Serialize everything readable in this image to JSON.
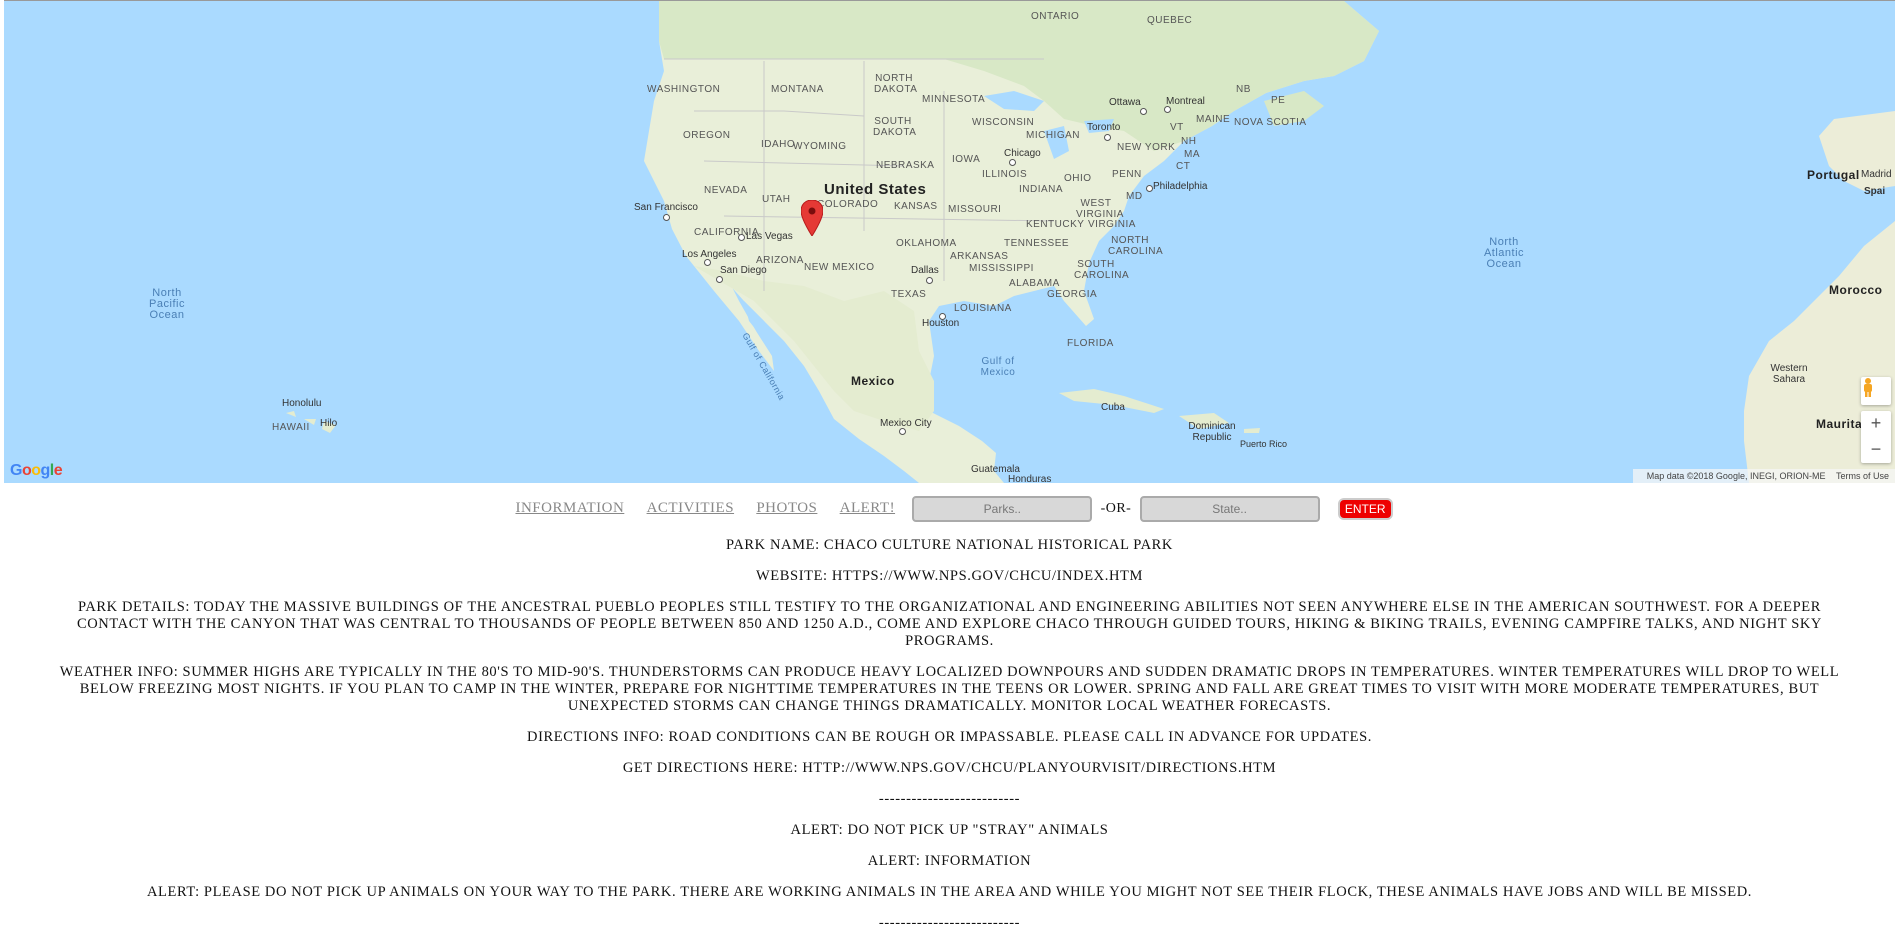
{
  "map": {
    "labels": {
      "united_states": "United States",
      "mexico": "Mexico",
      "portugal": "Portugal",
      "morocco": "Morocco",
      "mauritania": "Mauritania",
      "western_sahara": "Western Sahara",
      "cuba": "Cuba",
      "dominican_republic": "Dominican Republic",
      "puerto_rico": "Puerto Rico",
      "guatemala": "Guatemala",
      "honduras": "Honduras",
      "north_pacific_ocean": "North Pacific Ocean",
      "north_atlantic_ocean": "North Atlantic Ocean",
      "gulf_of_mexico": "Gulf of Mexico",
      "gulf_of_california": "Gulf of California",
      "ontario": "ONTARIO",
      "quebec": "QUEBEC",
      "washington": "WASHINGTON",
      "montana": "MONTANA",
      "north_dakota": "NORTH DAKOTA",
      "minnesota": "MINNESOTA",
      "south_dakota": "SOUTH DAKOTA",
      "wisconsin": "WISCONSIN",
      "michigan": "MICHIGAN",
      "oregon": "OREGON",
      "idaho": "IDAHO",
      "wyoming": "WYOMING",
      "nebraska": "NEBRASKA",
      "iowa": "IOWA",
      "illinois": "ILLINOIS",
      "indiana": "INDIANA",
      "ohio": "OHIO",
      "penn": "PENN",
      "nevada": "NEVADA",
      "utah": "UTAH",
      "colorado": "COLORADO",
      "kansas": "KANSAS",
      "missouri": "MISSOURI",
      "kentucky": "KENTUCKY",
      "west_virginia": "WEST VIRGINIA",
      "virginia": "VIRGINIA",
      "california": "CALIFORNIA",
      "arizona": "ARIZONA",
      "new_mexico": "NEW MEXICO",
      "oklahoma": "OKLAHOMA",
      "arkansas": "ARKANSAS",
      "tennessee": "TENNESSEE",
      "north_carolina": "NORTH CAROLINA",
      "south_carolina": "SOUTH CAROLINA",
      "mississippi": "MISSISSIPPI",
      "alabama": "ALABAMA",
      "georgia": "GEORGIA",
      "texas": "TEXAS",
      "louisiana": "LOUISIANA",
      "florida": "FLORIDA",
      "hawaii": "HAWAII",
      "new_york": "NEW YORK",
      "maine": "MAINE",
      "nova_scotia": "NOVA SCOTIA",
      "nb": "NB",
      "pe": "PE",
      "vt": "VT",
      "nh": "NH",
      "ma": "MA",
      "ct": "CT",
      "md": "MD",
      "san_francisco": "San Francisco",
      "las_vegas": "Las Vegas",
      "los_angeles": "Los Angeles",
      "san_diego": "San Diego",
      "dallas": "Dallas",
      "houston": "Houston",
      "chicago": "Chicago",
      "toronto": "Toronto",
      "ottawa": "Ottawa",
      "montreal": "Montreal",
      "philadelphia": "Philadelphia",
      "mexico_city": "Mexico City",
      "honolulu": "Honolulu",
      "hilo": "Hilo",
      "madrid": "Madrid",
      "spain": "Spai"
    },
    "attribution": "Map data ©2018 Google, INEGI, ORION-ME",
    "terms": "Terms of Use",
    "zoom_in": "+",
    "zoom_out": "−",
    "google_logo_letters": [
      "G",
      "o",
      "o",
      "g",
      "l",
      "e"
    ],
    "colors": {
      "water": "#aadaff",
      "land": "#e8eed8",
      "marker": "#e53935"
    }
  },
  "nav": {
    "information": "INFORMATION",
    "activities": "ACTIVITIES",
    "photos": "PHOTOS",
    "alert": "ALERT!",
    "parks_placeholder": "Parks..",
    "or_label": "-OR-",
    "state_placeholder": "State..",
    "enter": "ENTER"
  },
  "content": {
    "park_name": "PARK NAME: CHACO CULTURE NATIONAL HISTORICAL PARK",
    "website": "WEBSITE: HTTPS://WWW.NPS.GOV/CHCU/INDEX.HTM",
    "park_details": "PARK DETAILS: TODAY THE MASSIVE BUILDINGS OF THE ANCESTRAL PUEBLO PEOPLES STILL TESTIFY TO THE ORGANIZATIONAL AND ENGINEERING ABILITIES NOT SEEN ANYWHERE ELSE IN THE AMERICAN SOUTHWEST. FOR A DEEPER CONTACT WITH THE CANYON THAT WAS CENTRAL TO THOUSANDS OF PEOPLE BETWEEN 850 AND 1250 A.D., COME AND EXPLORE CHACO THROUGH GUIDED TOURS, HIKING & BIKING TRAILS, EVENING CAMPFIRE TALKS, AND NIGHT SKY PROGRAMS.",
    "weather_info": "WEATHER INFO: SUMMER HIGHS ARE TYPICALLY IN THE 80'S TO MID-90'S. THUNDERSTORMS CAN PRODUCE HEAVY LOCALIZED DOWNPOURS AND SUDDEN DRAMATIC DROPS IN TEMPERATURES. WINTER TEMPERATURES WILL DROP TO WELL BELOW FREEZING MOST NIGHTS. IF YOU PLAN TO CAMP IN THE WINTER, PREPARE FOR NIGHTTIME TEMPERATURES IN THE TEENS OR LOWER. SPRING AND FALL ARE GREAT TIMES TO VISIT WITH MORE MODERATE TEMPERATURES, BUT UNEXPECTED STORMS CAN CHANGE THINGS DRAMATICALLY. MONITOR LOCAL WEATHER FORECASTS.",
    "directions_info": "DIRECTIONS INFO: ROAD CONDITIONS CAN BE ROUGH OR IMPASSABLE. PLEASE CALL IN ADVANCE FOR UPDATES.",
    "get_directions": "GET DIRECTIONS HERE: HTTP://WWW.NPS.GOV/CHCU/PLANYOURVISIT/DIRECTIONS.HTM",
    "separator_1": "--------------------------",
    "alert_title": "ALERT: DO NOT PICK UP \"STRAY\" ANIMALS",
    "alert_category": "ALERT: INFORMATION",
    "alert_description": "ALERT: PLEASE DO NOT PICK UP ANIMALS ON YOUR WAY TO THE PARK. THERE ARE WORKING ANIMALS IN THE AREA AND WHILE YOU MIGHT NOT SEE THEIR FLOCK, THESE ANIMALS HAVE JOBS AND WILL BE MISSED.",
    "separator_2": "--------------------------"
  }
}
